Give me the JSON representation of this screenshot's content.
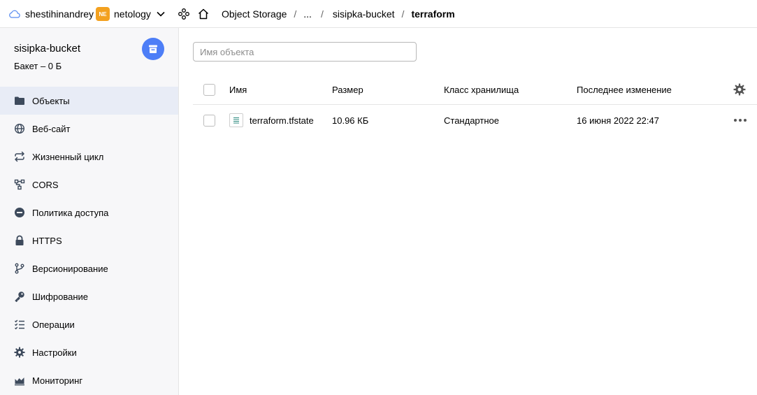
{
  "topbar": {
    "account": "shestihinandrey",
    "org_badge": "NE",
    "org_name": "netology",
    "breadcrumbs": [
      "Object Storage",
      "...",
      "sisipka-bucket",
      "terraform"
    ],
    "separator": "/"
  },
  "sidebar": {
    "bucket_name": "sisipka-bucket",
    "bucket_info": "Бакет – 0 Б",
    "items": [
      {
        "label": "Объекты",
        "icon": "folder-icon",
        "active": true
      },
      {
        "label": "Веб-сайт",
        "icon": "globe-icon"
      },
      {
        "label": "Жизненный цикл",
        "icon": "cycle-icon"
      },
      {
        "label": "CORS",
        "icon": "cors-icon"
      },
      {
        "label": "Политика доступа",
        "icon": "no-entry-icon"
      },
      {
        "label": "HTTPS",
        "icon": "lock-icon"
      },
      {
        "label": "Версионирование",
        "icon": "branch-icon"
      },
      {
        "label": "Шифрование",
        "icon": "key-icon"
      },
      {
        "label": "Операции",
        "icon": "checklist-icon"
      },
      {
        "label": "Настройки",
        "icon": "gear-icon"
      },
      {
        "label": "Мониторинг",
        "icon": "chart-icon"
      }
    ]
  },
  "main": {
    "search": {
      "placeholder": "Имя объекта",
      "value": ""
    },
    "table": {
      "columns": [
        "Имя",
        "Размер",
        "Класс хранилища",
        "Последнее изменение"
      ],
      "rows": [
        {
          "name": "terraform.tfstate",
          "size": "10.96 КБ",
          "storage_class": "Стандартное",
          "modified": "16 июня 2022 22:47"
        }
      ]
    }
  },
  "colors": {
    "accent": "#4d7ef7",
    "org_badge": "#f3a11f",
    "sidebar_active": "#e8ecf6",
    "icon": "#3d4a5c"
  }
}
